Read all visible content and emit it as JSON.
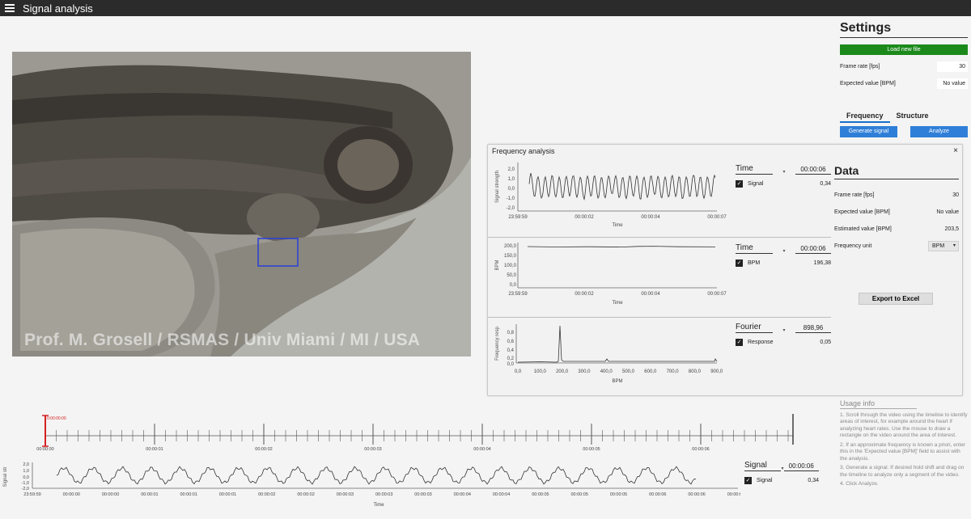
{
  "app": {
    "title": "Signal analysis"
  },
  "video": {
    "watermark": "Prof. M. Grosell / RSMAS / Univ Miami / MI / USA"
  },
  "settings": {
    "title": "Settings",
    "load_button": "Load new file",
    "frame_rate_label": "Frame rate [fps]",
    "frame_rate_value": "30",
    "expected_label": "Expected value [BPM]",
    "expected_value": "No value",
    "tabs": [
      {
        "label": "Frequency",
        "active": true
      },
      {
        "label": "Structure",
        "active": false
      }
    ],
    "generate_button": "Generate signal",
    "analyze_button": "Analyze"
  },
  "freq_panel": {
    "title": "Frequency analysis",
    "close": "×",
    "rows": [
      {
        "header": "Time",
        "header_value": "00:00:06",
        "check_label": "Signal",
        "check_value": "0,34"
      },
      {
        "header": "Time",
        "header_value": "00:00:06",
        "check_label": "BPM",
        "check_value": "196,38"
      },
      {
        "header": "Fourier",
        "header_value": "898,96",
        "check_label": "Response",
        "check_value": "0,05"
      }
    ],
    "data": {
      "title": "Data",
      "frame_rate_label": "Frame rate [fps]",
      "frame_rate_value": "30",
      "expected_label": "Expected value [BPM]",
      "expected_value": "No value",
      "estimated_label": "Estimated value [BPM]",
      "estimated_value": "203,5",
      "unit_label": "Frequency unit",
      "unit_value": "BPM",
      "export_button": "Export to Excel"
    }
  },
  "charts": {
    "signal": {
      "ylabel": "Signal strength",
      "xlabel": "Time",
      "yticks": [
        "2,0",
        "1,0",
        "0,0",
        "-1,0",
        "-2,0"
      ],
      "xticks": [
        "23:59:59",
        "00:00:02",
        "00:00:04",
        "00:00:07"
      ]
    },
    "bpm": {
      "ylabel": "BPM",
      "xlabel": "Time",
      "yticks": [
        "200,0",
        "150,0",
        "100,0",
        "50,0",
        "0,0"
      ],
      "xticks": [
        "23:59:59",
        "00:00:02",
        "00:00:04",
        "00:00:07"
      ]
    },
    "fourier": {
      "ylabel": "Frequency resp",
      "xlabel": "BPM",
      "yticks": [
        "0,8",
        "0,6",
        "0,4",
        "0,2",
        "0,0"
      ],
      "xticks": [
        "0,0",
        "100,0",
        "200,0",
        "300,0",
        "400,0",
        "500,0",
        "600,0",
        "700,0",
        "800,0",
        "900,0"
      ]
    },
    "bottom": {
      "ylabel": "Signal str",
      "xlabel": "Time",
      "yticks": [
        "2,0",
        "1,0",
        "0,0",
        "-1,0",
        "-2,0"
      ],
      "xticks": [
        "23:59:59",
        "00:00:00",
        "00:00:00",
        "00:00:01",
        "00:00:01",
        "00:00:01",
        "00:00:02",
        "00:00:02",
        "00:00:03",
        "00:00:03",
        "00:00:03",
        "00:00:04",
        "00:00:04",
        "00:00:05",
        "00:00:05",
        "00:00:05",
        "00:00:06",
        "00:00:06",
        "00:00:07"
      ]
    }
  },
  "timeline": {
    "cursor_label": "0:00:00:00",
    "labels": [
      "00:00:00",
      "00:00:01",
      "00:00:02",
      "00:00:03",
      "00:00:04",
      "00:00:05",
      "00:00:06"
    ]
  },
  "bottom_side": {
    "header": "Signal",
    "header_value": "00:00:06",
    "check_label": "Signal",
    "check_value": "0,34"
  },
  "usage": {
    "title": "Usage info",
    "steps": [
      "1. Scroll through the video using the timeline to identify areas of interest, for example around the heart if analyzing heart rates. Use the mouse to draw a rectangle on the video around the area of interest.",
      "2. If an approximate frequency is known a priori, enter this in the 'Expected value [BPM]' field to assist with the analysis.",
      "3. Generate a signal. If desired hold shift and drag on the timeline to analyze only a segment of the video.",
      "4. Click Analyze."
    ]
  },
  "colors": {
    "titlebar": "#2b2b2b",
    "green": "#1b8a1b",
    "blue": "#2f7fd8",
    "roi": "#2a3fd6",
    "cursor": "#d42020"
  }
}
